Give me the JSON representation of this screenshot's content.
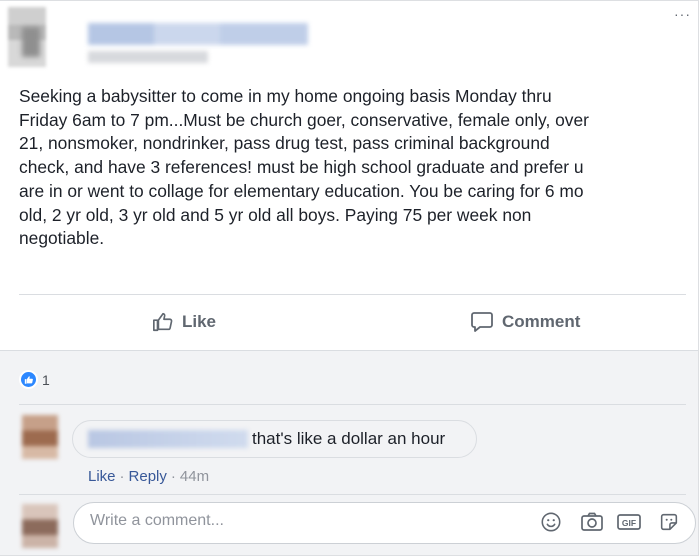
{
  "post": {
    "text": "Seeking a babysitter to come in my home ongoing basis Monday thru\nFriday 6am to 7 pm...Must be church goer, conservative, female only, over\n21, nonsmoker, nondrinker, pass drug test, pass criminal background\ncheck, and have 3 references! must be high school graduate and prefer u\nare in or went to collage for elementary education. You be caring for 6 mo\nold, 2 yr old, 3 yr old and 5 yr old all boys. Paying 75 per week non\nnegotiable.",
    "more_icon": "···"
  },
  "actions": {
    "like_label": "Like",
    "comment_label": "Comment"
  },
  "reactions": {
    "count": "1"
  },
  "comment": {
    "text": "that's like a dollar an hour",
    "like_label": "Like",
    "reply_label": "Reply",
    "time": "44m"
  },
  "composer": {
    "placeholder": "Write a comment..."
  },
  "icons": {
    "more": "more-options-icon",
    "like": "thumbs-up-icon",
    "comment": "speech-bubble-icon",
    "emoji": "emoji-icon",
    "camera": "camera-icon",
    "gif": "gif-icon",
    "sticker": "sticker-icon"
  },
  "colors": {
    "accent": "#385898",
    "like_blue": "#2d88ff",
    "muted": "#606770"
  }
}
